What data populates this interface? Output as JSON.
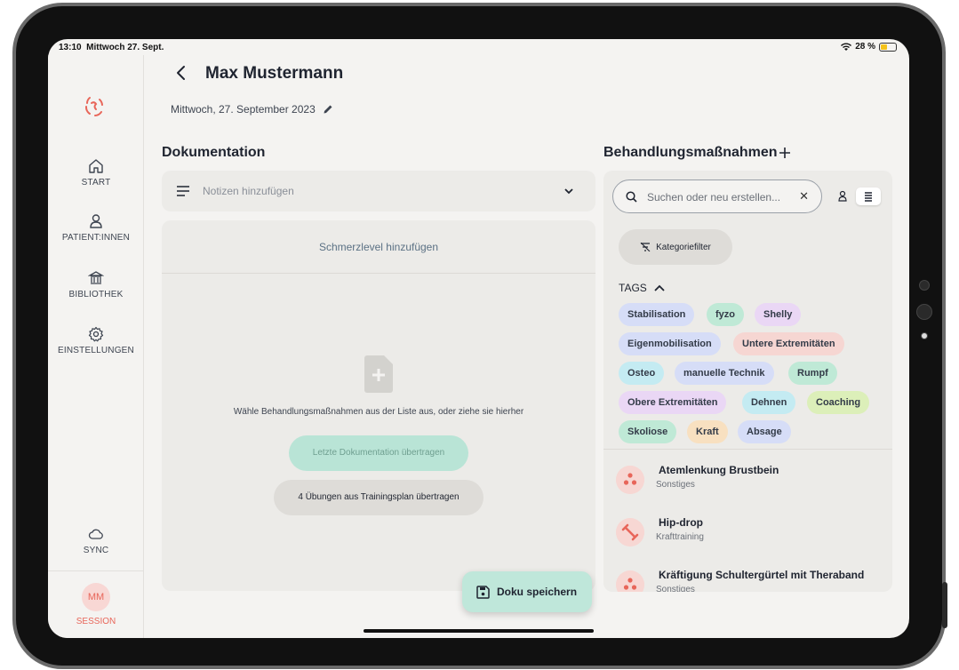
{
  "status": {
    "time": "13:10",
    "day": "Mittwoch 27. Sept.",
    "battery": "28 %"
  },
  "sidebar": {
    "items": [
      {
        "label": "START",
        "icon": "home-icon"
      },
      {
        "label": "PATIENT:INNEN",
        "icon": "person-icon"
      },
      {
        "label": "BIBLIOTHEK",
        "icon": "library-icon"
      },
      {
        "label": "EINSTELLUNGEN",
        "icon": "gear-icon"
      }
    ],
    "sync": "SYNC",
    "avatar": "MM",
    "session": "SESSION"
  },
  "header": {
    "title": "Max Mustermann",
    "date": "Mittwoch, 27. September 2023"
  },
  "doku": {
    "heading": "Dokumentation",
    "notes_placeholder": "Notizen hinzufügen",
    "pain": "Schmerzlevel hinzufügen",
    "hint": "Wähle Behandlungsmaßnahmen aus der Liste aus, oder ziehe sie hierher",
    "last_doc": "Letzte Dokumentation übertragen",
    "training": "4 Übungen aus Trainingsplan übertragen",
    "save": "Doku speichern"
  },
  "treat": {
    "heading": "Behandlungsmaßnahmen",
    "search_placeholder": "Suchen oder neu erstellen...",
    "category_filter": "Kategoriefilter",
    "tags_label": "TAGS",
    "tags": [
      {
        "label": "Stabilisation",
        "color": "#d6ddf7"
      },
      {
        "label": "fyzo",
        "color": "#bfe9d6"
      },
      {
        "label": "Shelly",
        "color": "#ead7f5"
      },
      {
        "label": "Eigenmobilisation",
        "color": "#d6ddf7"
      },
      {
        "label": "Untere Extremitäten",
        "color": "#f6d6d2"
      },
      {
        "label": "Osteo",
        "color": "#c4ebf2"
      },
      {
        "label": "manuelle Technik",
        "color": "#d6ddf7"
      },
      {
        "label": "Rumpf",
        "color": "#bfe9d6"
      },
      {
        "label": "Obere Extremitäten",
        "color": "#ead7f5"
      },
      {
        "label": "Dehnen",
        "color": "#c4ebf2"
      },
      {
        "label": "Coaching",
        "color": "#dcefb9"
      },
      {
        "label": "Skoliose",
        "color": "#bfe9d6"
      },
      {
        "label": "Kraft",
        "color": "#f8e0c0"
      },
      {
        "label": "Absage",
        "color": "#d6ddf7"
      }
    ],
    "exercises": [
      {
        "name": "Atemlenkung Brustbein",
        "category": "Sonstiges"
      },
      {
        "name": "Hip-drop",
        "category": "Krafttraining"
      },
      {
        "name": "Kräftigung Schultergürtel mit Theraband",
        "category": "Sonstiges"
      }
    ]
  }
}
